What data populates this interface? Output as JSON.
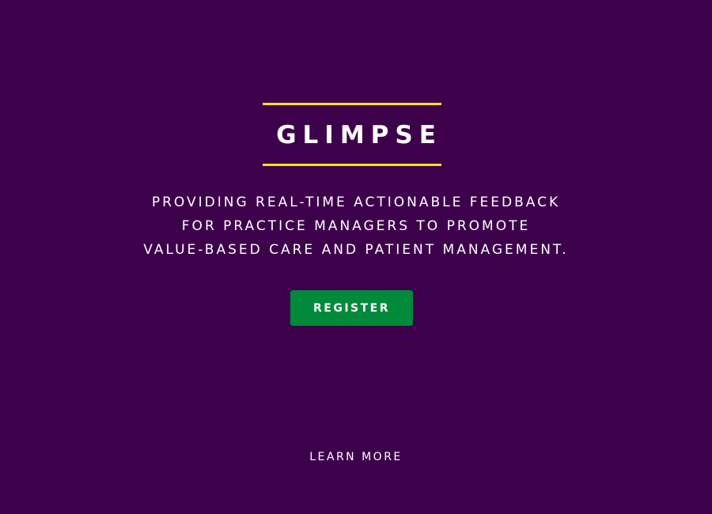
{
  "hero": {
    "title": "GLIMPSE",
    "tagline_lines": [
      "PROVIDING REAL-TIME ACTIONABLE FEEDBACK",
      "FOR PRACTICE MANAGERS TO PROMOTE",
      "VALUE-BASED CARE AND PATIENT MANAGEMENT."
    ],
    "register_label": "REGISTER",
    "learn_more_label": "LEARN MORE"
  },
  "colors": {
    "background": "#3d014b",
    "accent_rule": "#f5e31a",
    "button": "#008a3a",
    "text": "#ffffff"
  }
}
